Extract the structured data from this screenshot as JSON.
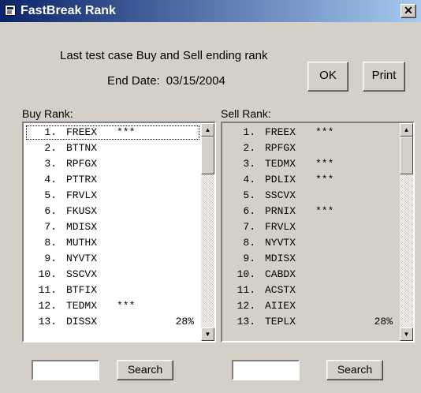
{
  "window": {
    "title": "FastBreak Rank",
    "close_label": "✕"
  },
  "header": {
    "caption": "Last test case Buy and Sell ending rank",
    "end_date_label": "End Date:",
    "end_date_value": "03/15/2004"
  },
  "buttons": {
    "ok": "OK",
    "print": "Print",
    "search": "Search"
  },
  "buy": {
    "label": "Buy Rank:",
    "search_value": "",
    "items": [
      {
        "rank": "1.",
        "symbol": "FREEX",
        "flag": "***",
        "pct": ""
      },
      {
        "rank": "2.",
        "symbol": "BTTNX",
        "flag": "",
        "pct": ""
      },
      {
        "rank": "3.",
        "symbol": "RPFGX",
        "flag": "",
        "pct": ""
      },
      {
        "rank": "4.",
        "symbol": "PTTRX",
        "flag": "",
        "pct": ""
      },
      {
        "rank": "5.",
        "symbol": "FRVLX",
        "flag": "",
        "pct": ""
      },
      {
        "rank": "6.",
        "symbol": "FKUSX",
        "flag": "",
        "pct": ""
      },
      {
        "rank": "7.",
        "symbol": "MDISX",
        "flag": "",
        "pct": ""
      },
      {
        "rank": "8.",
        "symbol": "MUTHX",
        "flag": "",
        "pct": ""
      },
      {
        "rank": "9.",
        "symbol": "NYVTX",
        "flag": "",
        "pct": ""
      },
      {
        "rank": "10.",
        "symbol": "SSCVX",
        "flag": "",
        "pct": ""
      },
      {
        "rank": "11.",
        "symbol": "BTFIX",
        "flag": "",
        "pct": ""
      },
      {
        "rank": "12.",
        "symbol": "TEDMX",
        "flag": "***",
        "pct": ""
      },
      {
        "rank": "13.",
        "symbol": "DISSX",
        "flag": "",
        "pct": "28%"
      }
    ]
  },
  "sell": {
    "label": "Sell Rank:",
    "search_value": "",
    "items": [
      {
        "rank": "1.",
        "symbol": "FREEX",
        "flag": "***",
        "pct": ""
      },
      {
        "rank": "2.",
        "symbol": "RPFGX",
        "flag": "",
        "pct": ""
      },
      {
        "rank": "3.",
        "symbol": "TEDMX",
        "flag": "***",
        "pct": ""
      },
      {
        "rank": "4.",
        "symbol": "PDLIX",
        "flag": "***",
        "pct": ""
      },
      {
        "rank": "5.",
        "symbol": "SSCVX",
        "flag": "",
        "pct": ""
      },
      {
        "rank": "6.",
        "symbol": "PRNIX",
        "flag": "***",
        "pct": ""
      },
      {
        "rank": "7.",
        "symbol": "FRVLX",
        "flag": "",
        "pct": ""
      },
      {
        "rank": "8.",
        "symbol": "NYVTX",
        "flag": "",
        "pct": ""
      },
      {
        "rank": "9.",
        "symbol": "MDISX",
        "flag": "",
        "pct": ""
      },
      {
        "rank": "10.",
        "symbol": "CABDX",
        "flag": "",
        "pct": ""
      },
      {
        "rank": "11.",
        "symbol": "ACSTX",
        "flag": "",
        "pct": ""
      },
      {
        "rank": "12.",
        "symbol": "AIIEX",
        "flag": "",
        "pct": ""
      },
      {
        "rank": "13.",
        "symbol": "TEPLX",
        "flag": "",
        "pct": "28%"
      }
    ]
  },
  "colors": {
    "titlebar_start": "#0a246a",
    "titlebar_end": "#a6caf0",
    "window_bg": "#d4d0c8"
  },
  "icons": {
    "app": "app-window-icon",
    "close": "close-icon",
    "scroll_up": "scroll-up-arrow-icon",
    "scroll_down": "scroll-down-arrow-icon"
  }
}
